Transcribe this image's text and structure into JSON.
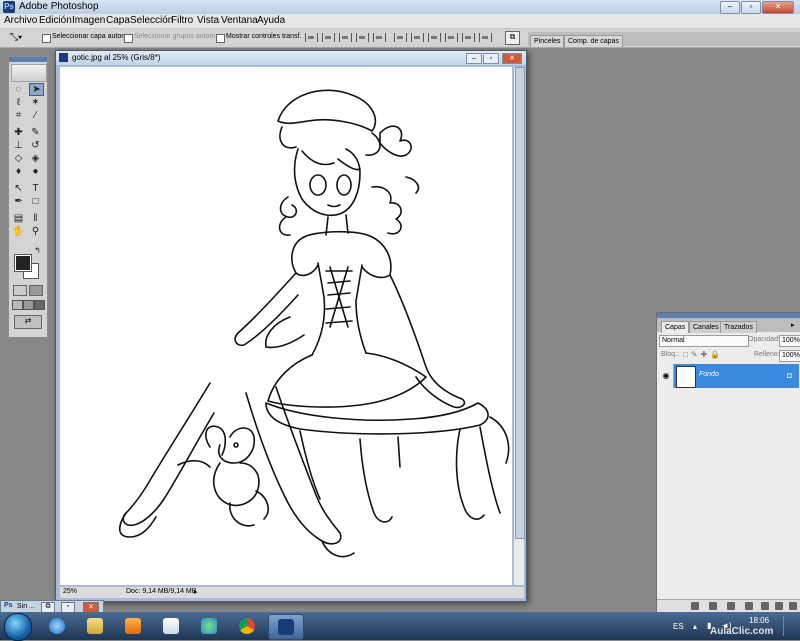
{
  "window": {
    "title": "Adobe Photoshop",
    "minimize": "–",
    "maximize": "▫",
    "close": "✕"
  },
  "menu": [
    "Archivo",
    "Edición",
    "Imagen",
    "Capa",
    "Selección",
    "Filtro",
    "Vista",
    "Ventana",
    "Ayuda"
  ],
  "options": {
    "auto_select_layer": "Seleccionar capa autom.",
    "auto_select_groups": "Seleccionar grupos autom.",
    "show_transform": "Mostrar controles transf."
  },
  "well_tabs": [
    "Pinceles",
    "Comp. de capas"
  ],
  "document": {
    "title": "gotic.jpg al 25% (Gris/8*)",
    "zoom": "25%",
    "doc_size": "Doc: 9,14 MB/9,14 MB"
  },
  "layers_panel": {
    "tabs": [
      "Capas",
      "Canales",
      "Trazados"
    ],
    "blend_mode": "Normal",
    "opacity_label": "Opacidad:",
    "opacity": "100%",
    "lock_label": "Bloq.:",
    "fill_label": "Relleno:",
    "fill": "100%",
    "layer_name": "Fondo"
  },
  "minimized_doc": {
    "label": "Sin ..."
  },
  "taskbar": {
    "language": "ES",
    "time": "18:06"
  },
  "watermark": "AulaClic.com",
  "colors": {
    "accent": "#3a8be0",
    "taskbar": "#2b4a70",
    "workspace": "#888888"
  }
}
